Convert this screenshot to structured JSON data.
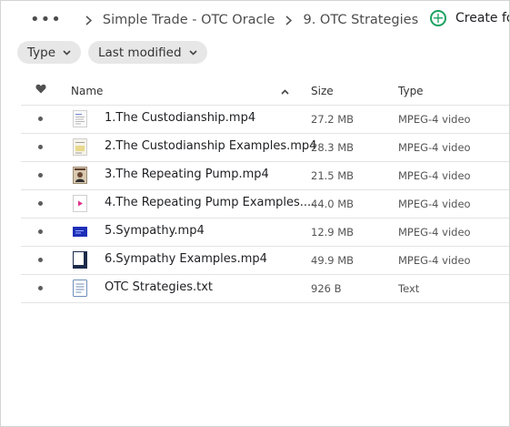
{
  "breadcrumb": {
    "items": [
      "Simple Trade - OTC Oracle",
      "9. OTC Strategies"
    ]
  },
  "actions": {
    "create_label": "Create fo"
  },
  "filters": {
    "type_label": "Type",
    "modified_label": "Last modified"
  },
  "table": {
    "headers": {
      "name": "Name",
      "size": "Size",
      "type": "Type"
    },
    "rows": [
      {
        "name": "1.The Custodianship.mp4",
        "size": "27.2 MB",
        "type": "MPEG-4 video",
        "thumb_icon": "doc-page-thumbnail"
      },
      {
        "name": "2.The Custodianship Examples.mp4",
        "size": "28.3 MB",
        "type": "MPEG-4 video",
        "thumb_icon": "chart-page-thumbnail"
      },
      {
        "name": "3.The Repeating Pump.mp4",
        "size": "21.5 MB",
        "type": "MPEG-4 video",
        "thumb_icon": "portrait-thumbnail"
      },
      {
        "name": "4.The Repeating Pump Examples....",
        "size": "44.0 MB",
        "type": "MPEG-4 video",
        "thumb_icon": "video-play-icon"
      },
      {
        "name": "5.Sympathy.mp4",
        "size": "12.9 MB",
        "type": "MPEG-4 video",
        "thumb_icon": "blue-slide-thumbnail"
      },
      {
        "name": "6.Sympathy Examples.mp4",
        "size": "49.9 MB",
        "type": "MPEG-4 video",
        "thumb_icon": "dark-slide-thumbnail"
      },
      {
        "name": "OTC Strategies.txt",
        "size": "926 B",
        "type": "Text",
        "thumb_icon": "text-file-icon"
      }
    ]
  },
  "colors": {
    "accent": "#1aa260",
    "chip_bg": "#e7e7e7",
    "row_border": "#e3e3e3"
  }
}
